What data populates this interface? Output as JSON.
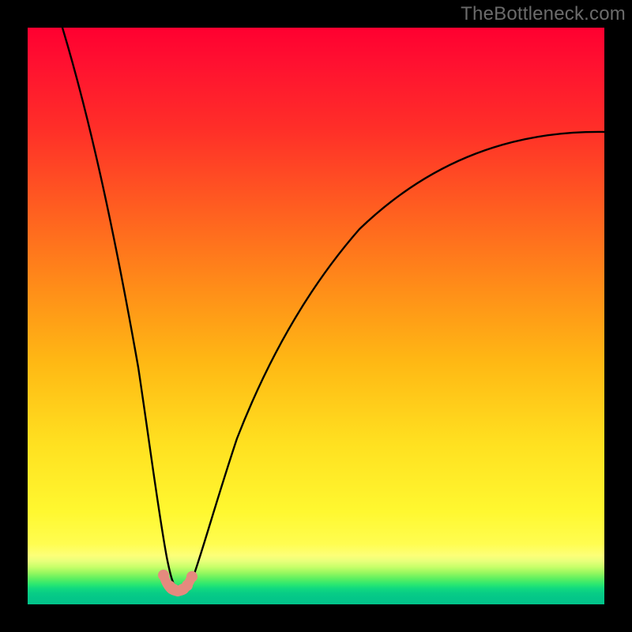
{
  "watermark": {
    "text": "TheBottleneck.com"
  },
  "chart_data": {
    "type": "line",
    "title": "",
    "xlabel": "",
    "ylabel": "",
    "xlim": [
      0,
      100
    ],
    "ylim": [
      0,
      100
    ],
    "note": "Axis values are estimated from pixel positions; no tick labels are present in the image. y maps top(red)=100 to bottom(green)=0. The curve depicts a bottleneck-style V with minimum near x≈26.",
    "series": [
      {
        "name": "bottleneck-curve",
        "x": [
          6.0,
          10.0,
          14.0,
          18.0,
          21.0,
          23.0,
          24.5,
          26.0,
          27.5,
          29.0,
          31.0,
          34.0,
          38.0,
          44.0,
          52.0,
          62.0,
          74.0,
          88.0,
          100.0
        ],
        "y": [
          100.0,
          80.0,
          58.0,
          36.0,
          18.0,
          8.0,
          3.0,
          2.4,
          3.0,
          7.0,
          15.0,
          26.0,
          38.0,
          50.0,
          60.0,
          68.0,
          74.5,
          79.0,
          82.0
        ]
      }
    ],
    "markers": {
      "name": "valley-markers",
      "color": "#e58a7e",
      "points": [
        {
          "x": 23.6,
          "y": 5.0
        },
        {
          "x": 24.6,
          "y": 3.2
        },
        {
          "x": 25.3,
          "y": 2.6
        },
        {
          "x": 26.0,
          "y": 2.4
        },
        {
          "x": 26.8,
          "y": 2.6
        },
        {
          "x": 27.6,
          "y": 3.2
        },
        {
          "x": 28.5,
          "y": 4.8
        }
      ]
    },
    "background_gradient": {
      "top_color": "#ff0030",
      "bottom_color": "#02c48a",
      "mid_colors": [
        "#ff9018",
        "#fff830",
        "#60f060"
      ]
    }
  }
}
